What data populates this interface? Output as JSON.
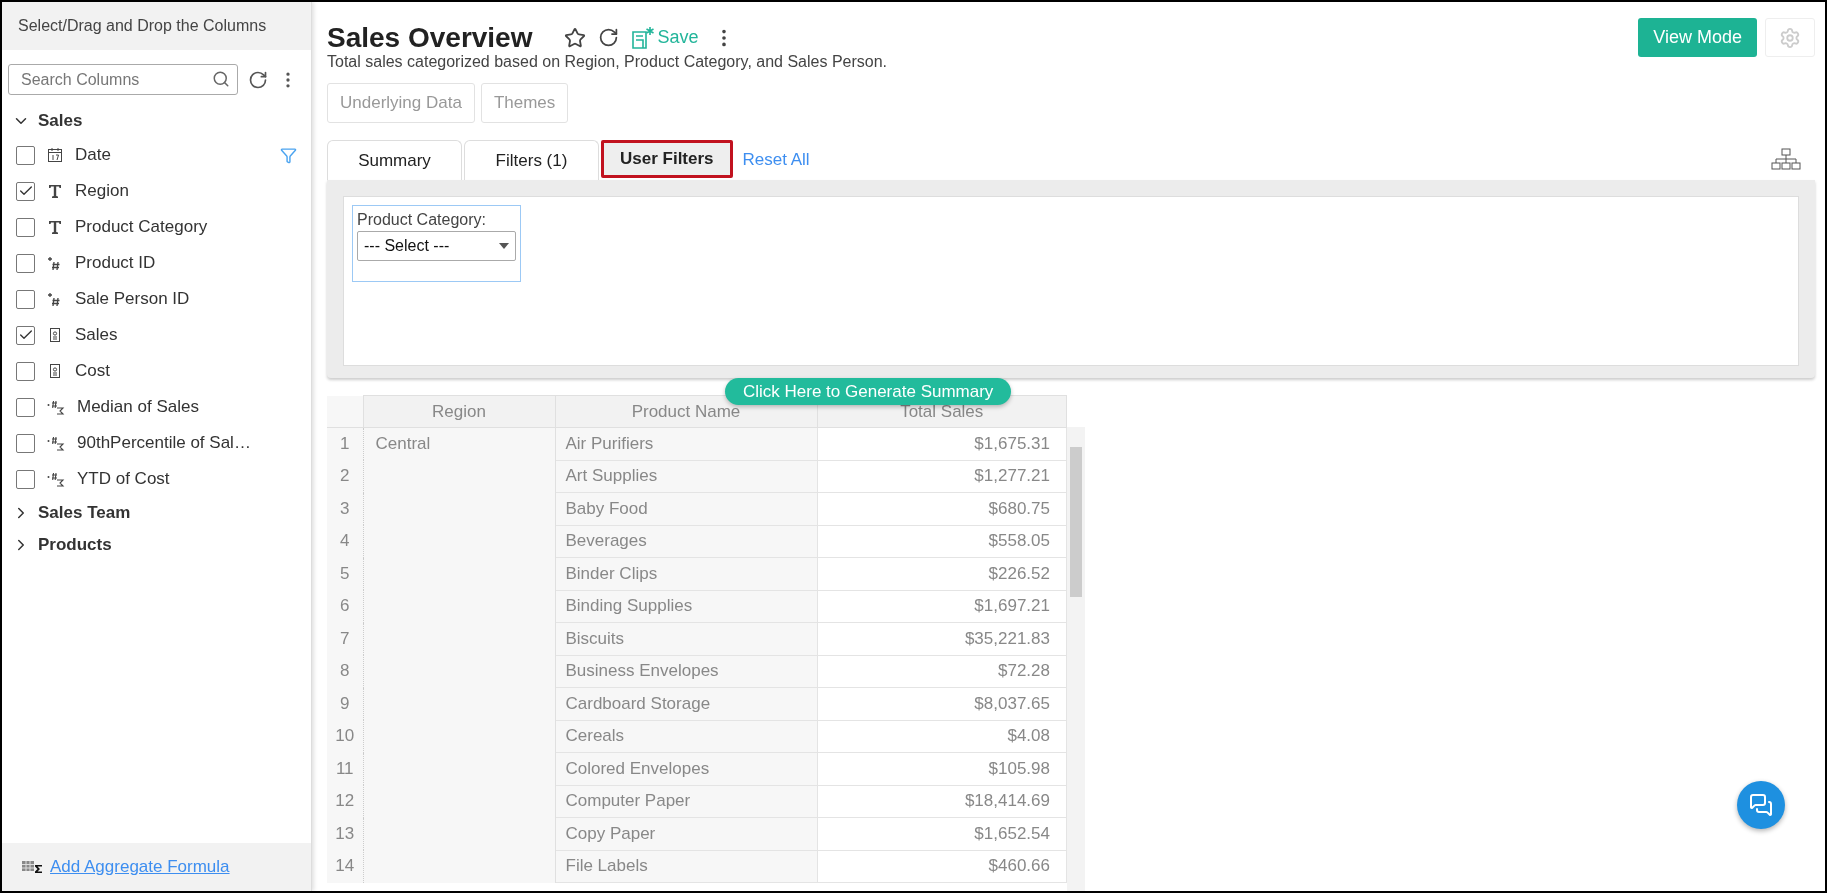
{
  "sidebar": {
    "title": "Select/Drag and Drop the Columns",
    "search": {
      "placeholder": "Search Columns"
    },
    "tree": [
      {
        "label": "Sales",
        "expanded": true,
        "children": [
          {
            "label": "Date",
            "kind": "date",
            "checked": false,
            "filtered": true
          },
          {
            "label": "Region",
            "kind": "text",
            "checked": true,
            "filtered": false
          },
          {
            "label": "Product Category",
            "kind": "text",
            "checked": false,
            "filtered": false
          },
          {
            "label": "Product ID",
            "kind": "number",
            "checked": false,
            "filtered": false
          },
          {
            "label": "Sale Person ID",
            "kind": "number",
            "checked": false,
            "filtered": false
          },
          {
            "label": "Sales",
            "kind": "currency",
            "checked": true,
            "filtered": false
          },
          {
            "label": "Cost",
            "kind": "currency",
            "checked": false,
            "filtered": false
          },
          {
            "label": "Median of Sales",
            "kind": "aggregate",
            "checked": false,
            "filtered": false
          },
          {
            "label": "90thPercentile of Sal…",
            "kind": "aggregate",
            "checked": false,
            "filtered": false
          },
          {
            "label": "YTD of Cost",
            "kind": "aggregate",
            "checked": false,
            "filtered": false
          }
        ]
      },
      {
        "label": "Sales Team",
        "expanded": false
      },
      {
        "label": "Products",
        "expanded": false
      }
    ],
    "footer_link": "Add Aggregate Formula"
  },
  "report": {
    "title": "Sales Overview",
    "save_label": "Save",
    "description": "Total sales categorized based on Region, Product Category, and Sales Person.",
    "view_mode": "View Mode",
    "actions": [
      "Underlying Data",
      "Themes"
    ],
    "tabs": [
      {
        "label": "Summary",
        "selected": false
      },
      {
        "label": "Filters (1)",
        "selected": false
      },
      {
        "label": "User Filters",
        "selected": true
      }
    ],
    "reset_all": "Reset All",
    "user_filters": [
      {
        "label": "Product Category:",
        "value": "--- Select ---"
      }
    ],
    "generate_button": "Click Here to Generate Summary"
  },
  "table": {
    "columns": [
      "Region",
      "Product Name",
      "Total Sales"
    ],
    "groups": [
      {
        "region": "Central",
        "rows": [
          {
            "num": "1",
            "product": "Air Purifiers",
            "total": "$1,675.31"
          },
          {
            "num": "2",
            "product": "Art Supplies",
            "total": "$1,277.21"
          },
          {
            "num": "3",
            "product": "Baby Food",
            "total": "$680.75"
          },
          {
            "num": "4",
            "product": "Beverages",
            "total": "$558.05"
          },
          {
            "num": "5",
            "product": "Binder Clips",
            "total": "$226.52"
          },
          {
            "num": "6",
            "product": "Binding Supplies",
            "total": "$1,697.21"
          },
          {
            "num": "7",
            "product": "Biscuits",
            "total": "$35,221.83"
          },
          {
            "num": "8",
            "product": "Business Envelopes",
            "total": "$72.28"
          },
          {
            "num": "9",
            "product": "Cardboard Storage",
            "total": "$8,037.65"
          },
          {
            "num": "10",
            "product": "Cereals",
            "total": "$4.08"
          },
          {
            "num": "11",
            "product": "Colored Envelopes",
            "total": "$105.98"
          },
          {
            "num": "12",
            "product": "Computer Paper",
            "total": "$18,414.69"
          },
          {
            "num": "13",
            "product": "Copy Paper",
            "total": "$1,652.54"
          },
          {
            "num": "14",
            "product": "File Labels",
            "total": "$460.66"
          }
        ]
      }
    ]
  }
}
